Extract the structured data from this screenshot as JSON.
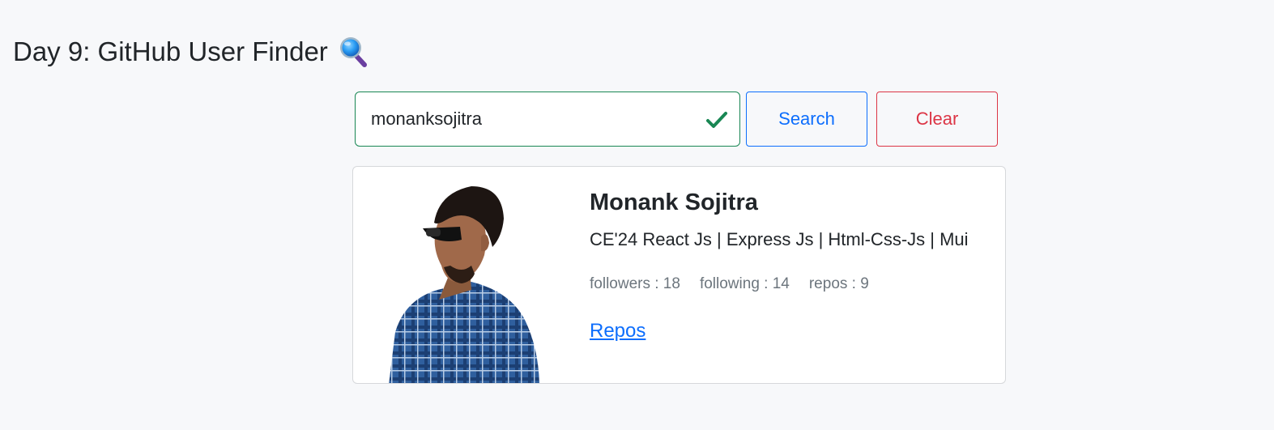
{
  "header": {
    "title": "Day 9: GitHub User Finder",
    "title_icon": "magnifying-glass-emoji-icon"
  },
  "search": {
    "value": "monanksojitra",
    "valid_icon": "checkmark-icon",
    "search_label": "Search",
    "clear_label": "Clear"
  },
  "user": {
    "name": "Monank Sojitra",
    "bio": "CE'24 React Js | Express Js | Html-Css-Js | Mui",
    "followers_text": "followers : 18",
    "following_text": "following : 14",
    "repos_text": "repos : 9",
    "repos_link_label": "Repos",
    "avatar_icon": "user-avatar-photo"
  },
  "colors": {
    "valid": "#198754",
    "primary": "#0d6efd",
    "danger": "#dc3545",
    "background": "#f7f8fa"
  }
}
